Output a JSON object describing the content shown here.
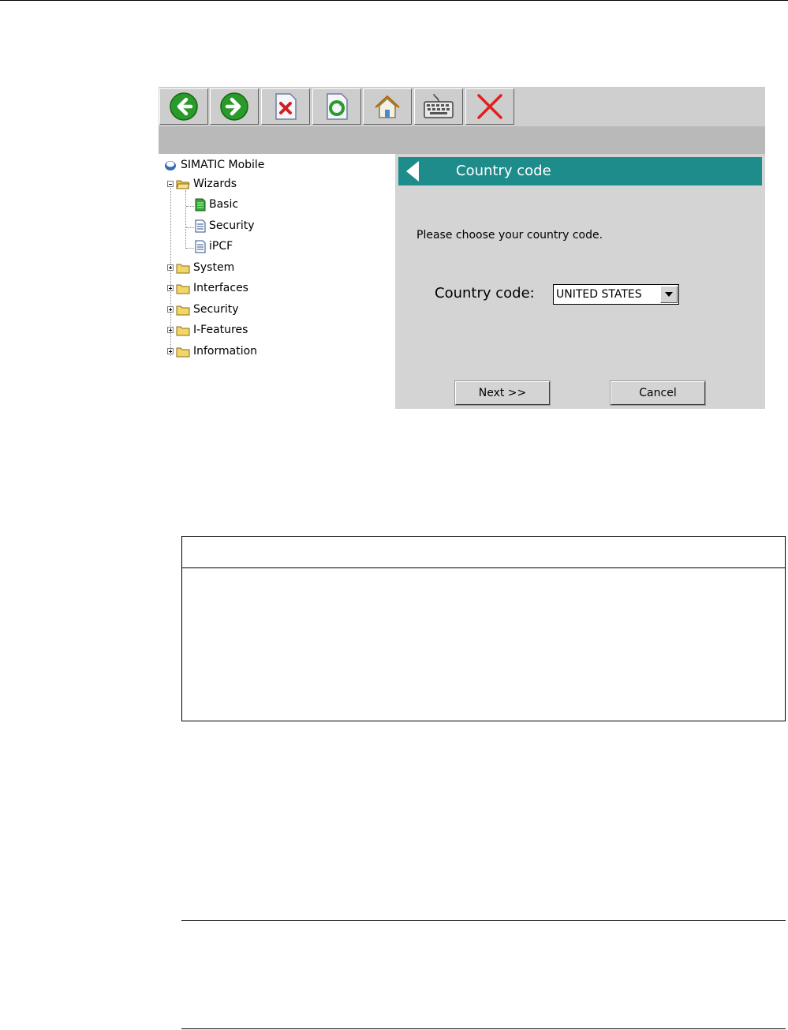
{
  "toolbar": {
    "buttons": [
      {
        "name": "back",
        "icon": "arrow-left-icon",
        "color": "#2a9b2a"
      },
      {
        "name": "forward",
        "icon": "arrow-right-icon",
        "color": "#2a9b2a"
      },
      {
        "name": "stop",
        "icon": "page-stop-icon",
        "color": "#d02020"
      },
      {
        "name": "refresh",
        "icon": "page-refresh-icon",
        "color": "#2a9b2a"
      },
      {
        "name": "home",
        "icon": "home-icon",
        "color": "#e8a020"
      },
      {
        "name": "keyboard",
        "icon": "keyboard-icon",
        "color": "#555555"
      },
      {
        "name": "close",
        "icon": "close-icon",
        "color": "#e02020"
      }
    ]
  },
  "tree": {
    "root": "SIMATIC Mobile",
    "wizards": "Wizards",
    "wizard_items": [
      "Basic",
      "Security",
      "iPCF"
    ],
    "folders": [
      "System",
      "Interfaces",
      "Security",
      "I-Features",
      "Information"
    ]
  },
  "pane": {
    "title": "Country code",
    "prompt": "Please choose your country code.",
    "field_label": "Country code:",
    "selected_value": "UNITED STATES",
    "next_label": "Next >>",
    "cancel_label": "Cancel",
    "header_color": "#1f8c8c"
  }
}
